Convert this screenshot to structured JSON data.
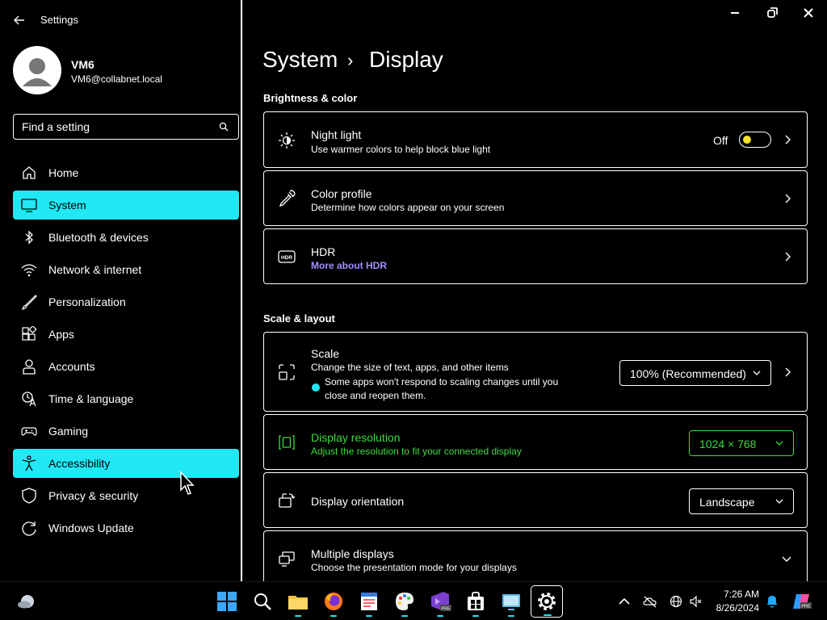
{
  "window": {
    "app_title": "Settings"
  },
  "user": {
    "name": "VM6",
    "email": "VM6@collabnet.local"
  },
  "search": {
    "placeholder": "Find a setting"
  },
  "nav": [
    {
      "label": "Home",
      "icon": "home-icon",
      "selected": false
    },
    {
      "label": "System",
      "icon": "monitor-icon",
      "selected": true
    },
    {
      "label": "Bluetooth & devices",
      "icon": "bluetooth-icon",
      "selected": false
    },
    {
      "label": "Network & internet",
      "icon": "wifi-icon",
      "selected": false
    },
    {
      "label": "Personalization",
      "icon": "brush-icon",
      "selected": false
    },
    {
      "label": "Apps",
      "icon": "apps-icon",
      "selected": false
    },
    {
      "label": "Accounts",
      "icon": "person-icon",
      "selected": false
    },
    {
      "label": "Time & language",
      "icon": "time-language-icon",
      "selected": false
    },
    {
      "label": "Gaming",
      "icon": "gamepad-icon",
      "selected": false
    },
    {
      "label": "Accessibility",
      "icon": "accessibility-icon",
      "selected": true
    },
    {
      "label": "Privacy & security",
      "icon": "shield-icon",
      "selected": false
    },
    {
      "label": "Windows Update",
      "icon": "update-icon",
      "selected": false
    }
  ],
  "breadcrumb": {
    "parent": "System",
    "separator": "›",
    "current": "Display"
  },
  "sections": {
    "brightness": {
      "heading": "Brightness & color",
      "night_light": {
        "title": "Night light",
        "subtitle": "Use warmer colors to help block blue light",
        "state": "Off"
      },
      "color_profile": {
        "title": "Color profile",
        "subtitle": "Determine how colors appear on your screen"
      },
      "hdr": {
        "title": "HDR",
        "link": "More about HDR"
      }
    },
    "scale_layout": {
      "heading": "Scale & layout",
      "scale": {
        "title": "Scale",
        "subtitle": "Change the size of text, apps, and other items",
        "note_line1": "Some apps won't respond to scaling changes until you",
        "note_line2": "close and reopen them.",
        "value": "100% (Recommended)"
      },
      "resolution": {
        "title": "Display resolution",
        "subtitle": "Adjust the resolution to fit your connected display",
        "value": "1024 × 768"
      },
      "orientation": {
        "title": "Display orientation",
        "value": "Landscape"
      },
      "multiple": {
        "title": "Multiple displays",
        "subtitle": "Choose the presentation mode for your displays"
      }
    }
  },
  "taskbar": {
    "time": "7:26 AM",
    "date": "8/26/2024"
  },
  "colors": {
    "accent": "#20e8f4",
    "highlight_green": "#3ddc3d",
    "link": "#9d92ff",
    "toggle_thumb": "#f2e32a"
  }
}
